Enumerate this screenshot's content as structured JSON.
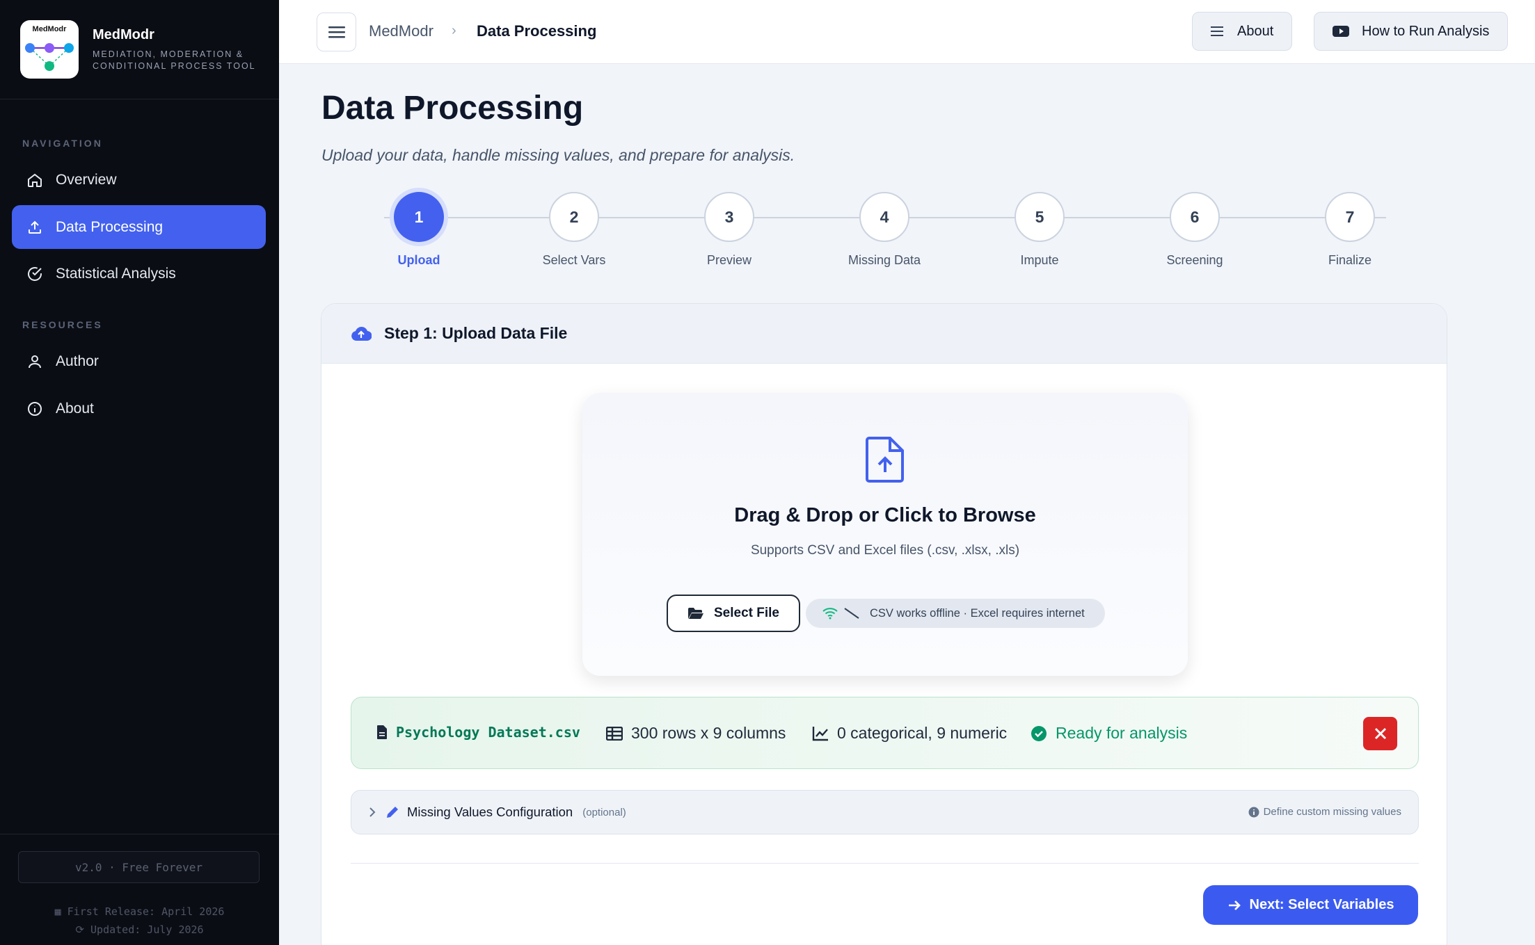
{
  "app": {
    "logo_text": "MedModr",
    "name": "MedModr",
    "subtitle": "MEDIATION, MODERATION & CONDITIONAL PROCESS TOOL"
  },
  "sidebar": {
    "nav_heading": "NAVIGATION",
    "nav_items": [
      {
        "label": "Overview",
        "icon": "home-icon",
        "active": false
      },
      {
        "label": "Data Processing",
        "icon": "upload-icon",
        "active": true
      },
      {
        "label": "Statistical Analysis",
        "icon": "check-circle-icon",
        "active": false
      }
    ],
    "resources_heading": "RESOURCES",
    "resource_items": [
      {
        "label": "Author",
        "icon": "user-icon"
      },
      {
        "label": "About",
        "icon": "info-icon"
      }
    ],
    "version": "v2.0 · Free Forever",
    "first_release": "First Release: April 2026",
    "updated": "Updated: July 2026"
  },
  "topbar": {
    "breadcrumb_app": "MedModr",
    "breadcrumb_current": "Data Processing",
    "about_label": "About",
    "how_to_label": "How to Run Analysis"
  },
  "page": {
    "title": "Data Processing",
    "subtitle": "Upload your data, handle missing values, and prepare for analysis."
  },
  "steps": [
    {
      "number": "1",
      "label": "Upload",
      "active": true
    },
    {
      "number": "2",
      "label": "Select Vars",
      "active": false
    },
    {
      "number": "3",
      "label": "Preview",
      "active": false
    },
    {
      "number": "4",
      "label": "Missing Data",
      "active": false
    },
    {
      "number": "5",
      "label": "Impute",
      "active": false
    },
    {
      "number": "6",
      "label": "Screening",
      "active": false
    },
    {
      "number": "7",
      "label": "Finalize",
      "active": false
    }
  ],
  "upload_card": {
    "header": "Step 1: Upload Data File",
    "dropzone_title": "Drag & Drop or Click to Browse",
    "dropzone_sub": "Supports CSV and Excel files (.csv, .xlsx, .xls)",
    "select_file_label": "Select File",
    "offline_note": "CSV works offline · Excel requires internet"
  },
  "file_info": {
    "file_name": "Psychology Dataset.csv",
    "dimensions": "300 rows x 9 columns",
    "types": "0 categorical, 9 numeric",
    "status": "Ready for analysis"
  },
  "missing_values": {
    "title": "Missing Values Configuration",
    "optional": "(optional)",
    "hint": "Define custom missing values"
  },
  "next_button": "Next: Select Variables",
  "colors": {
    "accent": "#4361ee",
    "sidebar_bg": "#0b0d14",
    "success": "#059669",
    "danger": "#dc2626"
  }
}
